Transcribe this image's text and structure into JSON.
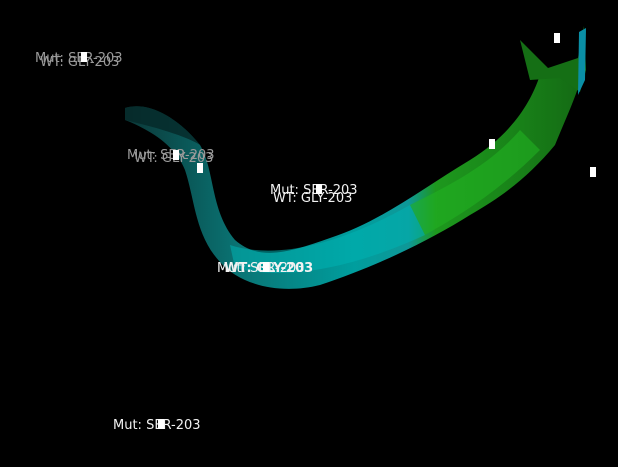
{
  "labels": {
    "mut_203": "Mut: SER-203",
    "wt_203": "WT: GLY-203"
  },
  "colors": {
    "background": "#000000",
    "ribbon_cyan": "#00a6a6",
    "ribbon_green": "#1fa01f",
    "label_bright": "#f2f2f2",
    "label_dim": "#9a9a9a"
  }
}
